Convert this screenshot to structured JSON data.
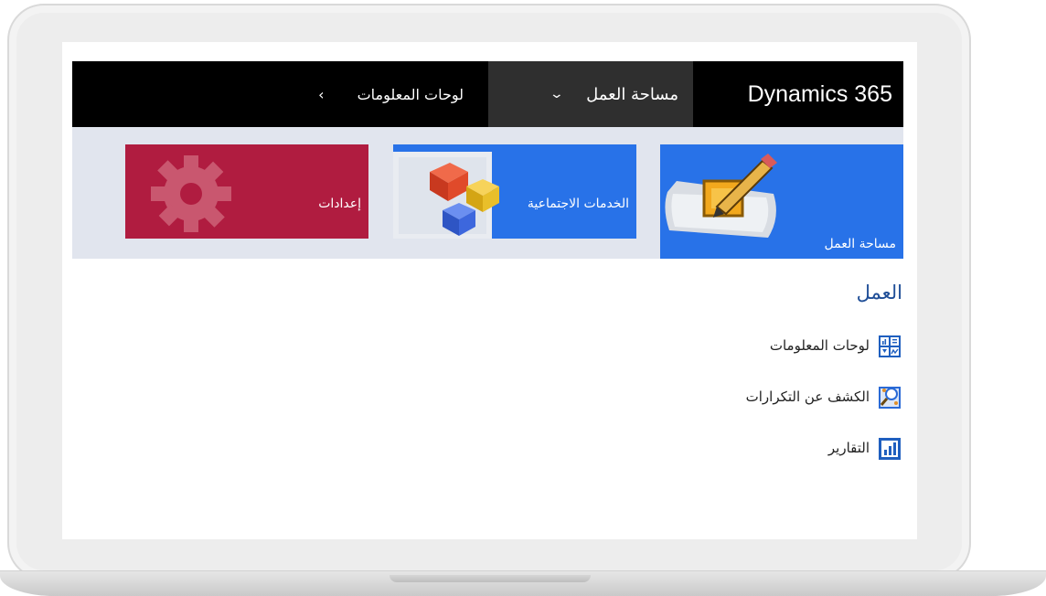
{
  "brand": {
    "name": "Dynamics 365"
  },
  "nav": {
    "area_label": "مساحة العمل",
    "breadcrumb_label": "لوحات المعلومات"
  },
  "tiles": {
    "workplace_label": "مساحة العمل",
    "social_label": "الخدمات الاجتماعية",
    "settings_label": "إعدادات"
  },
  "section": {
    "title": "العمل",
    "links": [
      {
        "label": "لوحات المعلومات",
        "icon": "dashboard-icon"
      },
      {
        "label": "الكشف عن التكرارات",
        "icon": "duplicate-detection-icon"
      },
      {
        "label": "التقارير",
        "icon": "reports-icon"
      }
    ]
  },
  "colors": {
    "navbar": "#000000",
    "area_selector": "#2f2f2f",
    "tile_blue": "#2872e8",
    "tile_red": "#b01c40",
    "tile_strip": "#e1e5ee",
    "section_title": "#1f4e97"
  }
}
